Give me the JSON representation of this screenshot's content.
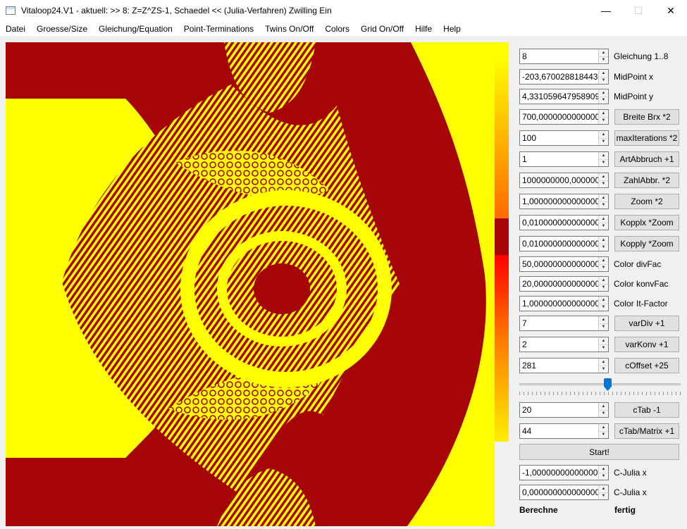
{
  "window": {
    "title": "Vitaloop24.V1 - aktuell: >> 8: Z=Z^ZS-1, Schaedel <<  (Julia-Verfahren)  Zwilling Ein",
    "minimize": "—",
    "maximize": "☐",
    "close": "✕"
  },
  "menu": [
    "Datei",
    "Groesse/Size",
    "Gleichung/Equation",
    "Point-Terminations",
    "Twins On/Off",
    "Colors",
    "Grid On/Off",
    "Hilfe",
    "Help"
  ],
  "colors": {
    "dark_red": "#a50505",
    "yellow": "#ffff00",
    "accent_blue": "#0078d7"
  },
  "fields": [
    {
      "value": "8",
      "label": "Gleichung 1..8",
      "kind": "label"
    },
    {
      "value": "-203,67002881844382",
      "label": "MidPoint x",
      "kind": "label"
    },
    {
      "value": "4,3310596479589094",
      "label": "MidPoint y",
      "kind": "label"
    },
    {
      "value": "700,0000000000000000",
      "label": "Breite Brx *2",
      "kind": "button"
    },
    {
      "value": "100",
      "label": "maxIterations *2",
      "kind": "button"
    },
    {
      "value": "1",
      "label": "ArtAbbruch +1",
      "kind": "button"
    },
    {
      "value": "1000000000,00000000",
      "label": "ZahlAbbr. *2",
      "kind": "button"
    },
    {
      "value": "1,0000000000000000",
      "label": "Zoom *2",
      "kind": "button"
    },
    {
      "value": "0,0100000000000000",
      "label": "Kopplx *Zoom",
      "kind": "button"
    },
    {
      "value": "0,0100000000000000",
      "label": "Kopply *Zoom",
      "kind": "button"
    },
    {
      "value": "50,0000000000000000",
      "label": "Color divFac",
      "kind": "label"
    },
    {
      "value": "20,0000000000000000",
      "label": "Color konvFac",
      "kind": "label"
    },
    {
      "value": "1,0000000000000000",
      "label": "Color It-Factor",
      "kind": "label"
    },
    {
      "value": "7",
      "label": "varDiv +1",
      "kind": "button"
    },
    {
      "value": "2",
      "label": "varKonv +1",
      "kind": "button"
    },
    {
      "value": "281",
      "label": "cOffset +25",
      "kind": "button"
    }
  ],
  "slider": {
    "value": 0.55
  },
  "ctab": [
    {
      "value": "20",
      "label": "cTab -1"
    },
    {
      "value": "44",
      "label": "cTab/Matrix +1"
    }
  ],
  "start_label": "Start!",
  "julia": [
    {
      "value": "-1,0000000000000000",
      "label": "C-Julia x"
    },
    {
      "value": "0,0000000000000000",
      "label": "C-Julia x"
    }
  ],
  "status": {
    "left": "Berechne",
    "right": "fertig"
  }
}
